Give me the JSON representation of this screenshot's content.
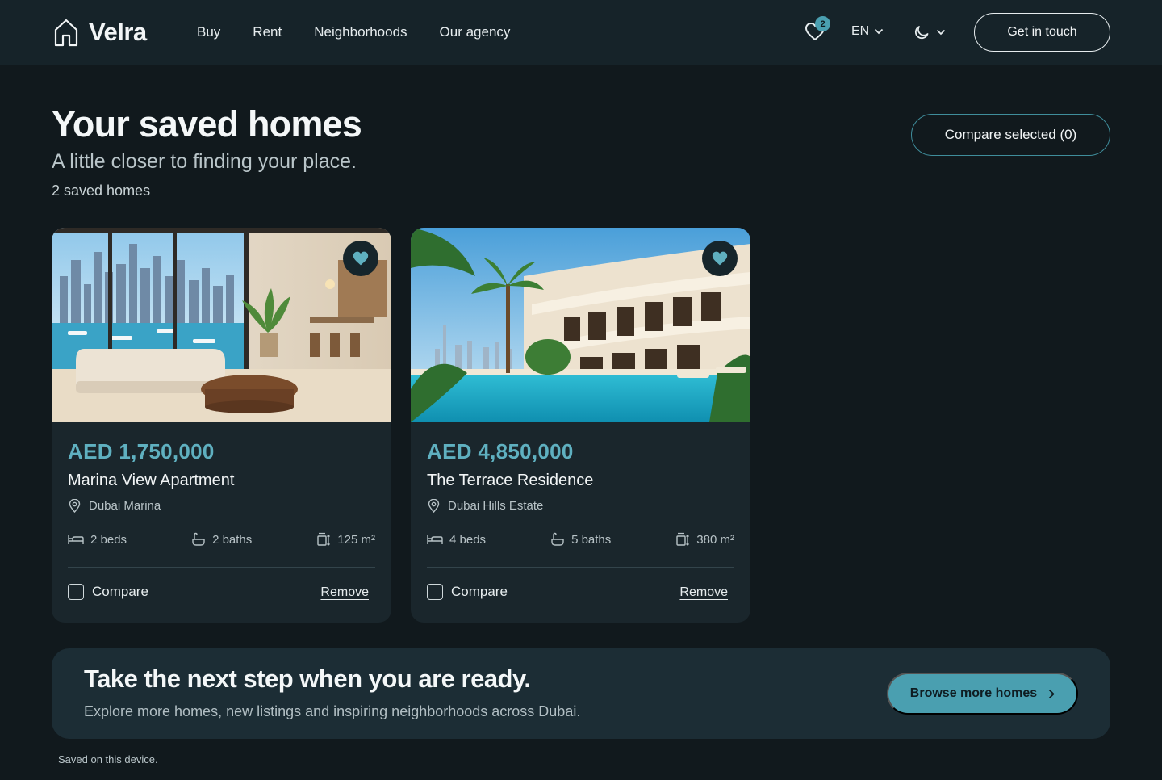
{
  "brand": {
    "name": "Velra"
  },
  "nav": {
    "items": [
      {
        "label": "Buy"
      },
      {
        "label": "Rent"
      },
      {
        "label": "Neighborhoods"
      },
      {
        "label": "Our agency"
      }
    ]
  },
  "header": {
    "favorites_count": "2",
    "language": "EN",
    "contact_label": "Get in touch"
  },
  "hero": {
    "title": "Your saved homes",
    "subtitle": "A little closer to finding your place.",
    "count": "2 saved homes",
    "compare_label": "Compare selected (0)"
  },
  "cards": [
    {
      "price": "AED 1,750,000",
      "name": "Marina View Apartment",
      "location": "Dubai Marina",
      "beds": "2 beds",
      "baths": "2 baths",
      "area": "125 m²",
      "compare_label": "Compare",
      "remove_label": "Remove"
    },
    {
      "price": "AED 4,850,000",
      "name": "The Terrace Residence",
      "location": "Dubai Hills Estate",
      "beds": "4 beds",
      "baths": "5 baths",
      "area": "380 m²",
      "compare_label": "Compare",
      "remove_label": "Remove"
    }
  ],
  "cta": {
    "title": "Take the next step when you are ready.",
    "subtitle": "Explore more homes, new listings and inspiring neighborhoods across Dubai.",
    "button_label": "Browse more homes"
  },
  "footer": {
    "note": "Saved on this device."
  },
  "colors": {
    "accent": "#4a9fb0",
    "price": "#5fb0c0",
    "background": "#11191d",
    "card": "#1a262c"
  }
}
